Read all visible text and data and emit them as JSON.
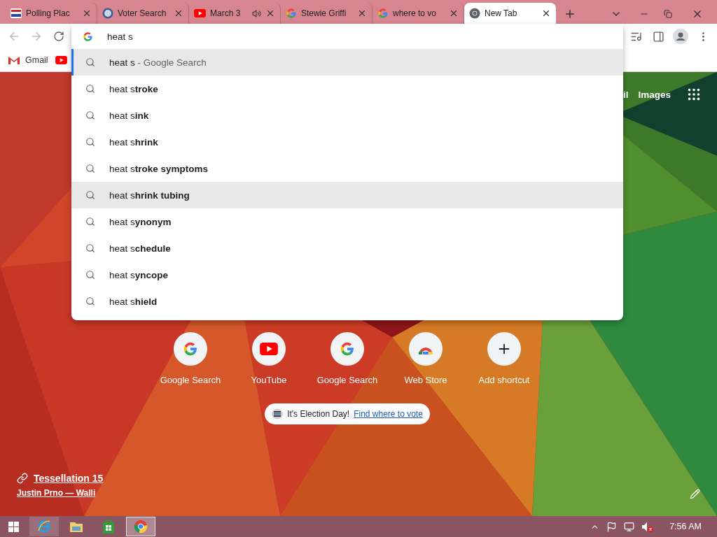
{
  "tabs": [
    {
      "title": "Polling Plac",
      "selected": false,
      "audio": false
    },
    {
      "title": "Voter Search",
      "selected": false,
      "audio": false
    },
    {
      "title": "March 3",
      "selected": false,
      "audio": true
    },
    {
      "title": "Stewie Griffi",
      "selected": false,
      "audio": false
    },
    {
      "title": "where to vo",
      "selected": false,
      "audio": false
    },
    {
      "title": "New Tab",
      "selected": true,
      "audio": false
    }
  ],
  "omnibox": {
    "value": "heat s"
  },
  "suggestions": [
    {
      "text": "heat s",
      "suffix": " - Google Search",
      "selected": true,
      "hovered": false
    },
    {
      "text": "heat s**troke**",
      "selected": false,
      "hovered": false
    },
    {
      "text": "heat s**ink**",
      "selected": false,
      "hovered": false
    },
    {
      "text": "heat s**hrink**",
      "selected": false,
      "hovered": false
    },
    {
      "text": "heat s**troke symptoms**",
      "selected": false,
      "hovered": false
    },
    {
      "text": "heat s**hrink tubing**",
      "selected": false,
      "hovered": true
    },
    {
      "text": "heat s**ynonym**",
      "selected": false,
      "hovered": false
    },
    {
      "text": "heat s**chedule**",
      "selected": false,
      "hovered": false
    },
    {
      "text": "heat s**yncope**",
      "selected": false,
      "hovered": false
    },
    {
      "text": "heat s**hield**",
      "selected": false,
      "hovered": false
    }
  ],
  "bookmarks": [
    "Gmail"
  ],
  "header_links": [
    "il",
    "Images"
  ],
  "shortcuts": [
    "Google Search",
    "YouTube",
    "Google Search",
    "Web Store",
    "Add shortcut"
  ],
  "promo": {
    "text": "It's Election Day!",
    "link": "Find where to vote"
  },
  "attribution": {
    "title": "Tessellation 15",
    "author": "Justin Prno — Walli"
  },
  "taskbar": {
    "apps": [
      {
        "selected": false,
        "hovered": true
      },
      {
        "selected": false,
        "hovered": false
      },
      {
        "selected": false,
        "hovered": false
      },
      {
        "selected": true,
        "hovered": false
      }
    ],
    "clock": "7:56 AM"
  }
}
